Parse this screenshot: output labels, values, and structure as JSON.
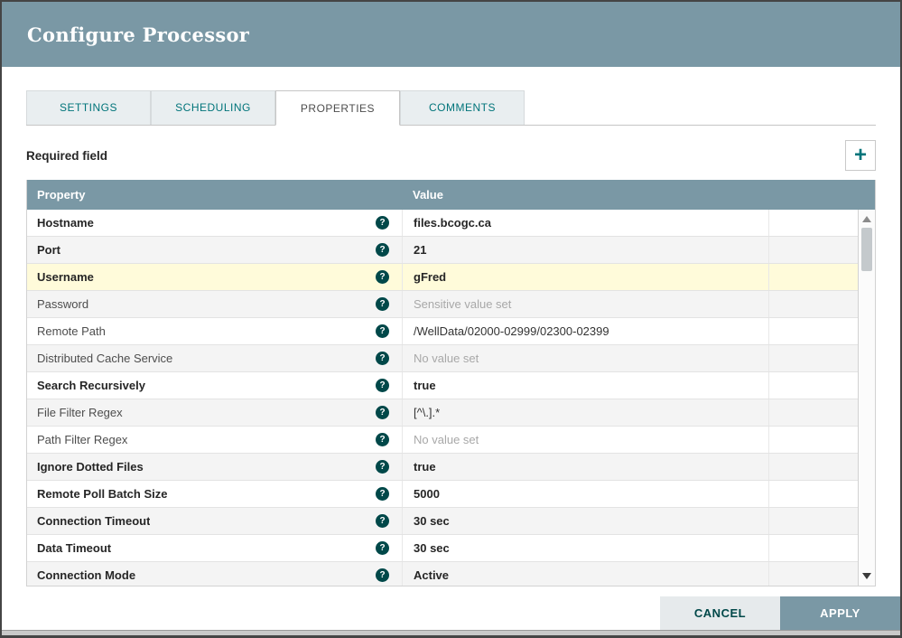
{
  "dialog": {
    "title": "Configure Processor",
    "tabs": [
      {
        "label": "SETTINGS",
        "active": false
      },
      {
        "label": "SCHEDULING",
        "active": false
      },
      {
        "label": "PROPERTIES",
        "active": true
      },
      {
        "label": "COMMENTS",
        "active": false
      }
    ],
    "required_field_label": "Required field",
    "icons": {
      "add": "+",
      "help": "?"
    },
    "table": {
      "columns": {
        "property": "Property",
        "value": "Value"
      },
      "rows": [
        {
          "property": "Hostname",
          "value": "files.bcogc.ca",
          "required": true,
          "placeholder": false,
          "highlighted": false
        },
        {
          "property": "Port",
          "value": "21",
          "required": true,
          "placeholder": false,
          "highlighted": false
        },
        {
          "property": "Username",
          "value": "gFred",
          "required": true,
          "placeholder": false,
          "highlighted": true
        },
        {
          "property": "Password",
          "value": "Sensitive value set",
          "required": false,
          "placeholder": true,
          "highlighted": false
        },
        {
          "property": "Remote Path",
          "value": "/WellData/02000-02999/02300-02399",
          "required": false,
          "placeholder": false,
          "highlighted": false
        },
        {
          "property": "Distributed Cache Service",
          "value": "No value set",
          "required": false,
          "placeholder": true,
          "highlighted": false
        },
        {
          "property": "Search Recursively",
          "value": "true",
          "required": true,
          "placeholder": false,
          "highlighted": false
        },
        {
          "property": "File Filter Regex",
          "value": "[^\\.].*",
          "required": false,
          "placeholder": false,
          "highlighted": false
        },
        {
          "property": "Path Filter Regex",
          "value": "No value set",
          "required": false,
          "placeholder": true,
          "highlighted": false
        },
        {
          "property": "Ignore Dotted Files",
          "value": "true",
          "required": true,
          "placeholder": false,
          "highlighted": false
        },
        {
          "property": "Remote Poll Batch Size",
          "value": "5000",
          "required": true,
          "placeholder": false,
          "highlighted": false
        },
        {
          "property": "Connection Timeout",
          "value": "30 sec",
          "required": true,
          "placeholder": false,
          "highlighted": false
        },
        {
          "property": "Data Timeout",
          "value": "30 sec",
          "required": true,
          "placeholder": false,
          "highlighted": false
        },
        {
          "property": "Connection Mode",
          "value": "Active",
          "required": true,
          "placeholder": false,
          "highlighted": false
        }
      ]
    },
    "footer": {
      "cancel": "CANCEL",
      "apply": "APPLY"
    },
    "colors": {
      "header_bg": "#7A98A5",
      "accent_teal": "#00747A",
      "help_icon_bg": "#004849",
      "highlight_row": "#FFFBDA",
      "cancel_bg": "#E6EAEC",
      "apply_bg": "#7A98A5"
    }
  }
}
